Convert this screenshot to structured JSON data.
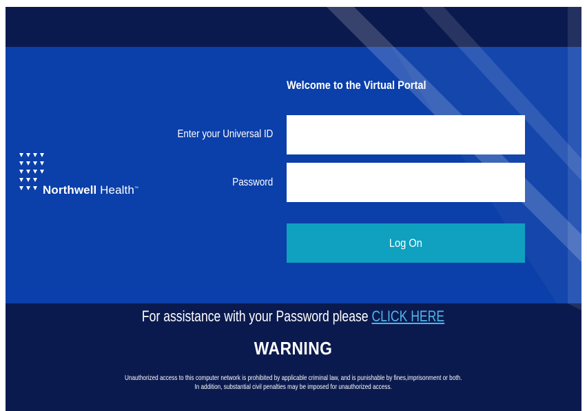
{
  "brand": {
    "name_bold": "Northwell",
    "name_light": " Health",
    "trademark": "™",
    "logo_icon": "triangle-grid-icon"
  },
  "form": {
    "welcome": "Welcome to the Virtual Portal",
    "uid_label": "Enter your Universal ID",
    "uid_value": "",
    "password_label": "Password",
    "password_value": "",
    "logon_label": "Log On"
  },
  "assistance": {
    "text": "For assistance with your Password please ",
    "link": "CLICK HERE"
  },
  "warning": {
    "title": "WARNING",
    "line1": "Unauthorized access to this computer network is prohibited by applicable criminal law, and is punishable by fines,imprisonment or both.",
    "line2": "In addition, substantial civil penalties may be imposed for unauthorized access."
  },
  "colors": {
    "dark_navy": "#0b1a4e",
    "panel_blue": "#0b3fa9",
    "button_teal": "#0fa1bf",
    "link_blue": "#4eb6ee"
  }
}
